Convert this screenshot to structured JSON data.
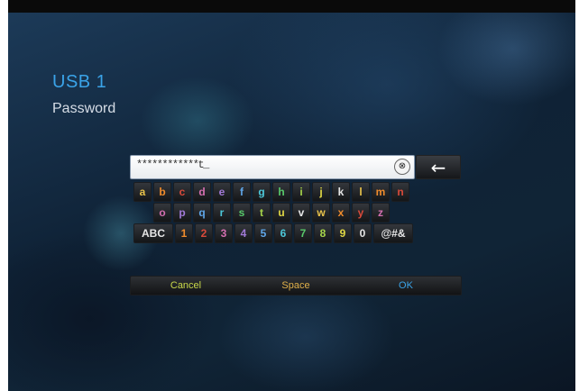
{
  "header": {
    "device": "USB 1",
    "field_label": "Password"
  },
  "input": {
    "value": "************t_",
    "clear_label": "⊗",
    "backspace_label": "←"
  },
  "keyboard": {
    "row1": [
      "a",
      "b",
      "c",
      "d",
      "e",
      "f",
      "g",
      "h",
      "i",
      "j",
      "k",
      "l",
      "m",
      "n"
    ],
    "row2": [
      "o",
      "p",
      "q",
      "r",
      "s",
      "t",
      "u",
      "v",
      "w",
      "x",
      "y",
      "z"
    ],
    "row3_mode": "ABC",
    "row3": [
      "1",
      "2",
      "3",
      "4",
      "5",
      "6",
      "7",
      "8",
      "9",
      "0"
    ],
    "row3_symbols": "@#&",
    "bottom": {
      "cancel": "Cancel",
      "space": "Space",
      "ok": "OK"
    }
  },
  "colors": {
    "key_palette": [
      "#e8c24a",
      "#f08c2c",
      "#d94a3a",
      "#d46fb0",
      "#a27ad8",
      "#5fa6e8",
      "#4cc7d8",
      "#58c96a",
      "#a6d44a",
      "#e0d844",
      "#e6e6e6"
    ]
  }
}
